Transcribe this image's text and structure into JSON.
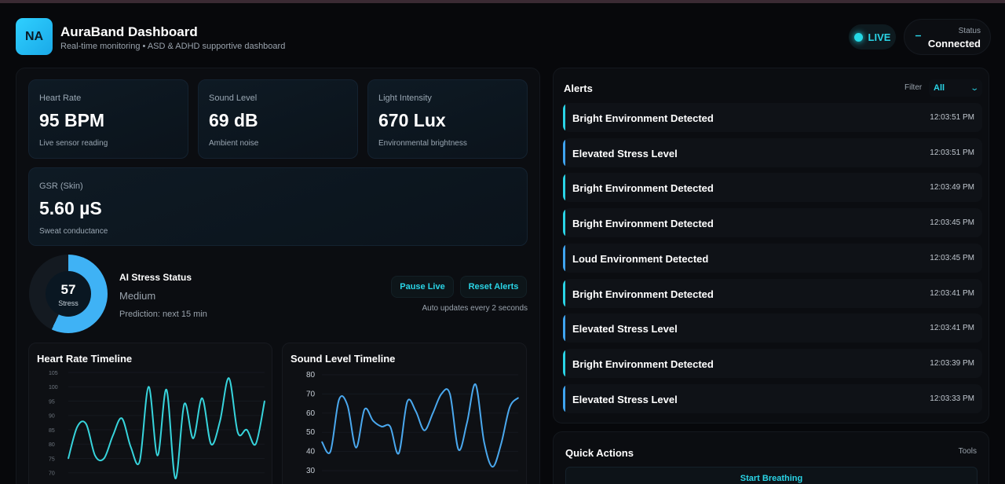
{
  "header": {
    "logo_initials": "NA",
    "title": "AuraBand Dashboard",
    "subtitle": "Real-time monitoring • ASD & ADHD supportive dashboard",
    "live_label": "LIVE",
    "status_label": "Status",
    "status_value": "Connected"
  },
  "metrics": [
    {
      "label": "Heart Rate",
      "value": "95 BPM",
      "note": "Live sensor reading"
    },
    {
      "label": "Sound Level",
      "value": "69 dB",
      "note": "Ambient noise"
    },
    {
      "label": "Light Intensity",
      "value": "670 Lux",
      "note": "Environmental brightness"
    },
    {
      "label": "GSR (Skin)",
      "value": "5.60 µS",
      "note": "Sweat conductance"
    }
  ],
  "stress": {
    "score": "57",
    "score_fraction": 0.57,
    "caption": "Stress",
    "title": "AI Stress Status",
    "level": "Medium",
    "prediction": "Prediction: next 15 min",
    "pause_label": "Pause Live",
    "reset_label": "Reset Alerts",
    "auto_note": "Auto updates every 2 seconds"
  },
  "colors": {
    "accent": "#2ad4e6",
    "alert_bright": "#2ad4e6",
    "alert_other": "#3fa4f0",
    "heart_line": "#37d4dc",
    "sound_line": "#4aa8ee"
  },
  "alerts": {
    "title": "Alerts",
    "filter_label": "Filter",
    "filter_value": "All",
    "items": [
      {
        "text": "Bright Environment Detected",
        "time": "12:03:51 PM",
        "kind": "bright"
      },
      {
        "text": "Elevated Stress Level",
        "time": "12:03:51 PM",
        "kind": "stress"
      },
      {
        "text": "Bright Environment Detected",
        "time": "12:03:49 PM",
        "kind": "bright"
      },
      {
        "text": "Bright Environment Detected",
        "time": "12:03:45 PM",
        "kind": "bright"
      },
      {
        "text": "Loud Environment Detected",
        "time": "12:03:45 PM",
        "kind": "loud"
      },
      {
        "text": "Bright Environment Detected",
        "time": "12:03:41 PM",
        "kind": "bright"
      },
      {
        "text": "Elevated Stress Level",
        "time": "12:03:41 PM",
        "kind": "stress"
      },
      {
        "text": "Bright Environment Detected",
        "time": "12:03:39 PM",
        "kind": "bright"
      },
      {
        "text": "Elevated Stress Level",
        "time": "12:03:33 PM",
        "kind": "stress"
      }
    ]
  },
  "quick_actions": {
    "title": "Quick Actions",
    "tools_label": "Tools",
    "start_breathing_label": "Start Breathing"
  },
  "chart_data": [
    {
      "type": "line",
      "title": "Heart Rate Timeline",
      "ylim": [
        68,
        105
      ],
      "yticks": [
        70,
        75,
        80,
        85,
        90,
        95,
        100,
        105
      ],
      "y_tick_labels": [
        "70",
        "75",
        "80",
        "85",
        "90",
        "95",
        "100",
        "105"
      ],
      "values": [
        75,
        86,
        87,
        76,
        75,
        83,
        89,
        79,
        74,
        100,
        76,
        99,
        68,
        94,
        82,
        96,
        80,
        88,
        103,
        84,
        85,
        80,
        95
      ]
    },
    {
      "type": "line",
      "title": "Sound Level Timeline",
      "ylim": [
        30,
        80
      ],
      "yticks": [
        30,
        40,
        50,
        60,
        70,
        80
      ],
      "y_tick_labels": [
        "30",
        "40",
        "50",
        "60",
        "70",
        "80"
      ],
      "values": [
        45,
        40,
        67,
        64,
        42,
        62,
        56,
        53,
        53,
        39,
        66,
        61,
        51,
        60,
        70,
        70,
        41,
        55,
        75,
        45,
        32,
        44,
        63,
        68
      ]
    }
  ]
}
